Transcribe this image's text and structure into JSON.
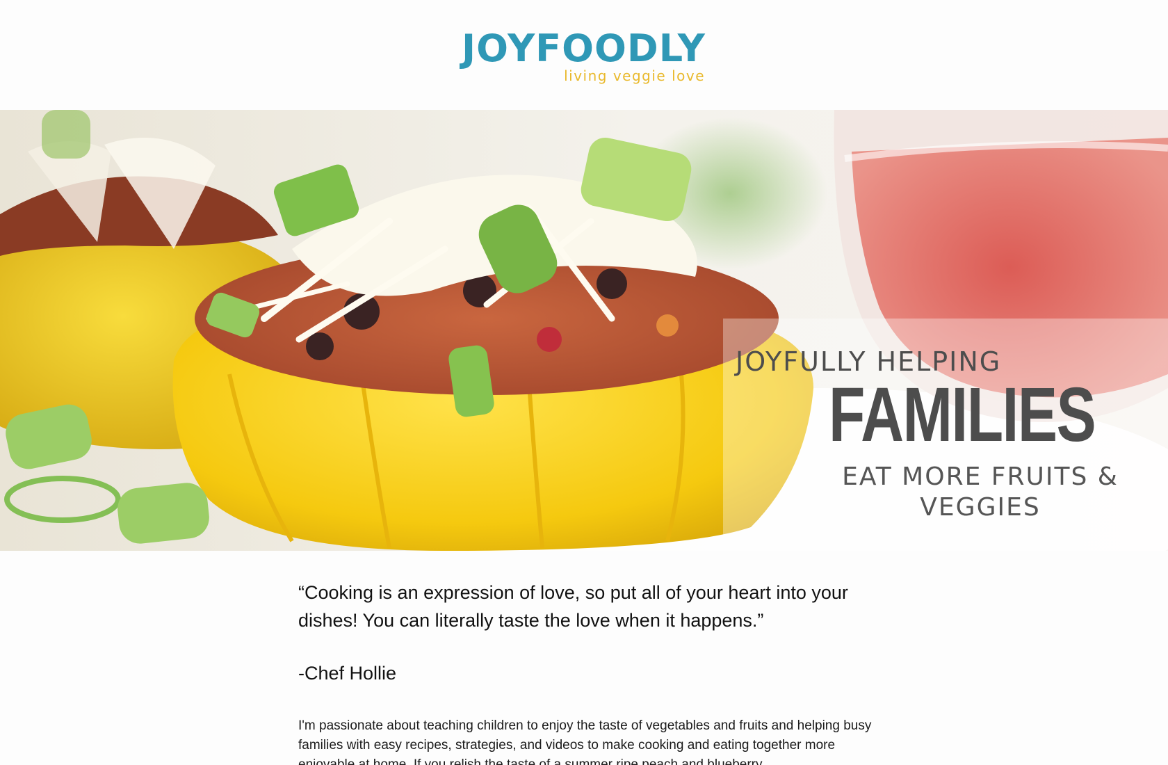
{
  "logo": {
    "name": "JOYFOODLY",
    "tagline": "living veggie love",
    "brand_color": "#2f98b6",
    "tagline_color": "#e9b92c"
  },
  "hero": {
    "line1": "JOYFULLY HELPING",
    "line2": "FAMILIES",
    "line3": "EAT MORE FRUITS & VEGGIES",
    "text_color": "#4d4d4d"
  },
  "content": {
    "quote": "“Cooking is an expression of love, so put all of your heart into your dishes! You can literally taste the love when it happens.”",
    "attribution": "-Chef Hollie",
    "intro": "I'm passionate about teaching children to enjoy the taste of vegetables and fruits and helping busy families with easy recipes, strategies, and videos to make cooking and eating together more enjoyable at home. If you relish the taste of a summer ripe peach and blueberry"
  }
}
